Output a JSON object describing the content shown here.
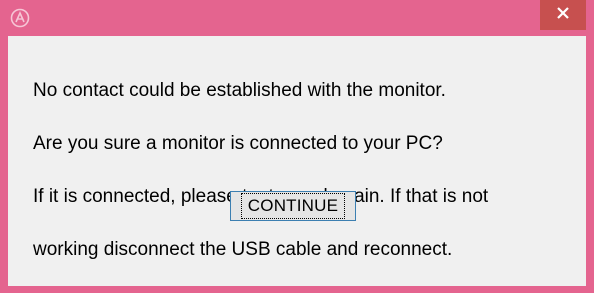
{
  "dialog": {
    "close_glyph": "✕",
    "app_icon": "app-logo-icon",
    "message_lines": [
      "No contact could be established with the monitor.",
      "Are you sure a monitor is connected to your PC?",
      "If it is connected, please try to read again. If that is not",
      "working disconnect the USB cable and reconnect."
    ],
    "continue_label": "CONTINUE"
  },
  "colors": {
    "title_bar": "#e4648f",
    "close_button": "#c7504f",
    "client_background": "#f0f0f0",
    "button_border": "#3c7fb1"
  }
}
